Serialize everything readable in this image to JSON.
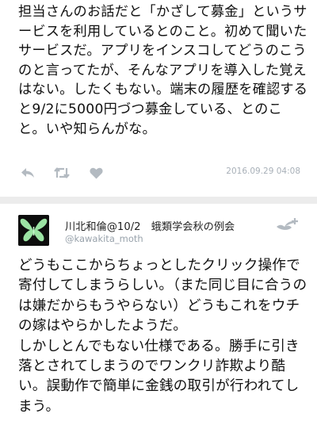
{
  "tweet1": {
    "text": "担当さんのお話だと「かざして募金」というサービスを利用しているとのこと。初めて聞いたサービスだ。アプリをインスコしてどうのこうのと言ってたが、そんなアプリを導入した覚えはない。したくもない。端末の履歴を確認すると9/2に5000円づつ募金している、とのこと。いや知らんがな。",
    "timestamp": "2016.09.29 04:08",
    "actions": {
      "reply_icon": "reply-icon",
      "retweet_icon": "retweet-icon",
      "like_icon": "heart-icon"
    }
  },
  "tweet2": {
    "author_name": "川北和倫@10/2　蛾類学会秋の例会",
    "author_handle": "@kawakita_moth",
    "follow_icon": "follow-user-icon",
    "text": "どうもここからちょっとしたクリック操作で寄付してしまうらしい。（また同じ目に合うのは嫌だからもうやらない）どうもこれをウチの嫁はやらかしたようだ。\nしかしとんでもない仕様である。勝手に引き落とされてしまうのでワンクリ詐欺より酷い。誤動作で簡単に金銭の取引が行われてしまう。"
  },
  "colors": {
    "icon": "#b3bac1",
    "timestamp": "#a8b0b8",
    "divider": "#ececec",
    "avatar_bg": "#0d0d0d",
    "moth": "#9be3a3"
  }
}
